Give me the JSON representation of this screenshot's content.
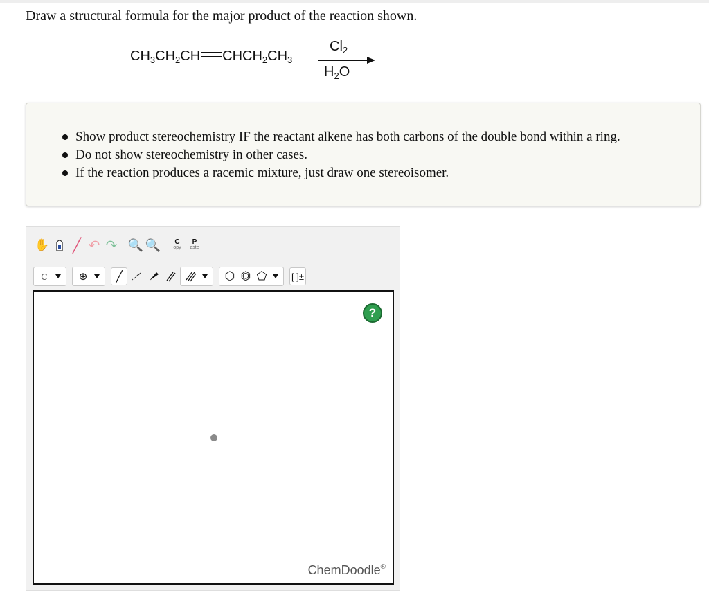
{
  "question": "Draw a structural formula for the major product of the reaction shown.",
  "reaction": {
    "reactant_left": [
      "CH",
      "3",
      "CH",
      "2",
      "CH"
    ],
    "reactant_right": [
      "CHCH",
      "2",
      "CH",
      "3"
    ],
    "reagent_top": [
      "Cl",
      "2"
    ],
    "reagent_bottom": [
      "H",
      "2",
      "O"
    ]
  },
  "instructions": [
    "Show product stereochemistry IF the reactant alkene has both carbons of the double bond within a ring.",
    "Do not show stereochemistry in other cases.",
    "If the reaction produces a racemic mixture, just draw one stereoisomer."
  ],
  "toolbar": {
    "copy_main": "C",
    "copy_sub": "opy",
    "paste_main": "P",
    "paste_sub": "aste",
    "element_label": "C",
    "bracket_label": "[ ]±",
    "icons": [
      "hand-icon",
      "lasso-icon",
      "eraser-icon",
      "undo-icon",
      "redo-icon",
      "zoom-in-icon",
      "zoom-out-icon",
      "copy-icon",
      "paste-icon",
      "charge-icon",
      "single-bond-icon",
      "stereo-hashed-bond-icon",
      "stereo-wedge-bond-icon",
      "double-bond-icon",
      "triple-bond-icon",
      "cyclohexane-icon",
      "benzene-icon",
      "cyclopentane-icon",
      "bracket-icon"
    ]
  },
  "canvas": {
    "help_label": "?",
    "brand": "ChemDoodle",
    "brand_mark": "®"
  },
  "colors": {
    "help": "#2f9e4f",
    "instructions_bg": "#f8f8f3"
  }
}
